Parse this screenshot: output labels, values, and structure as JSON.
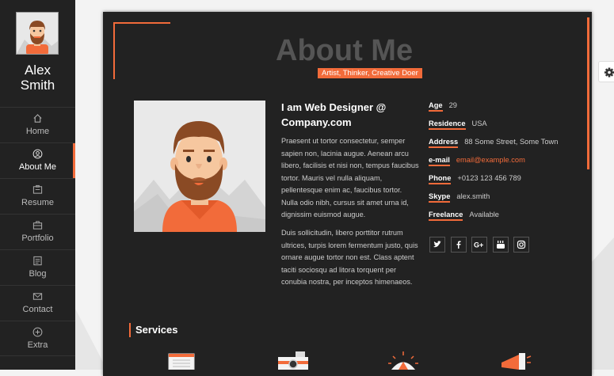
{
  "profile": {
    "first_name": "Alex",
    "last_name": "Smith"
  },
  "nav": {
    "items": [
      {
        "label": "Home",
        "icon": "home-icon"
      },
      {
        "label": "About Me",
        "icon": "user-icon",
        "active": true
      },
      {
        "label": "Resume",
        "icon": "resume-icon"
      },
      {
        "label": "Portfolio",
        "icon": "portfolio-icon"
      },
      {
        "label": "Blog",
        "icon": "blog-icon"
      },
      {
        "label": "Contact",
        "icon": "contact-icon"
      },
      {
        "label": "Extra",
        "icon": "plus-circle-icon"
      }
    ]
  },
  "page": {
    "title": "About Me",
    "subtitle": "Artist, Thinker, Creative Doer"
  },
  "bio": {
    "heading": "I am Web Designer @ Company.com",
    "paragraph1": "Praesent ut tortor consectetur, semper sapien non, lacinia augue. Aenean arcu libero, facilisis et nisi non, tempus faucibus tortor. Mauris vel nulla aliquam, pellentesque enim ac, faucibus tortor. Nulla odio nibh, cursus sit amet urna id, dignissim euismod augue.",
    "paragraph2": "Duis sollicitudin, libero porttitor rutrum ultrices, turpis lorem fermentum justo, quis ornare augue tortor non est. Class aptent taciti sociosqu ad litora torquent per conubia nostra, per inceptos himenaeos."
  },
  "info": [
    {
      "key": "Age",
      "value": "29"
    },
    {
      "key": "Residence",
      "value": "USA"
    },
    {
      "key": "Address",
      "value": "88 Some Street, Some Town"
    },
    {
      "key": "e-mail",
      "value": "email@example.com",
      "link": true
    },
    {
      "key": "Phone",
      "value": "+0123 123 456 789"
    },
    {
      "key": "Skype",
      "value": "alex.smith"
    },
    {
      "key": "Freelance",
      "value": "Available"
    }
  ],
  "social": [
    {
      "icon": "twitter-icon"
    },
    {
      "icon": "facebook-icon"
    },
    {
      "icon": "google-plus-icon"
    },
    {
      "icon": "youtube-icon"
    },
    {
      "icon": "instagram-icon"
    }
  ],
  "services": {
    "heading": "Services",
    "icons": [
      "newspaper-icon",
      "camera-icon",
      "sunrise-icon",
      "megaphone-icon"
    ]
  },
  "colors": {
    "accent": "#f26b3a",
    "sidebar": "#222222",
    "card": "#222222"
  }
}
